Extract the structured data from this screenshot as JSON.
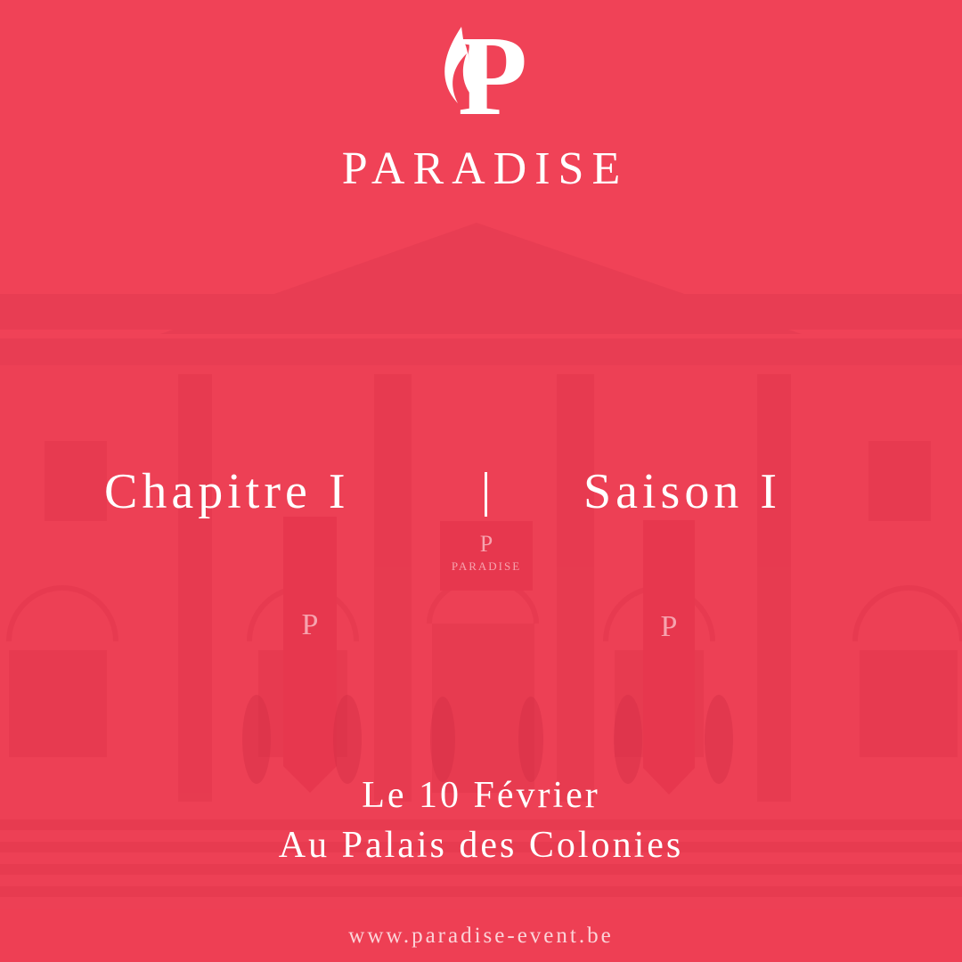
{
  "brand": {
    "name": "PARADISE",
    "logo_letter": "P",
    "logo_icon": "paradise-p-flame-monogram"
  },
  "banners": {
    "center_label": "PARADISE",
    "monogram": "P"
  },
  "headline": {
    "chapter": "Chapitre I",
    "separator_icon": "vertical-bar",
    "season": "Saison I"
  },
  "event": {
    "date": "Le 10 Février",
    "venue": "Au Palais des Colonies"
  },
  "footer": {
    "url": "www.paradise-event.be"
  },
  "colors": {
    "background": "#f04257",
    "overlay_shadow": "#d9334a",
    "text": "#ffffff"
  }
}
